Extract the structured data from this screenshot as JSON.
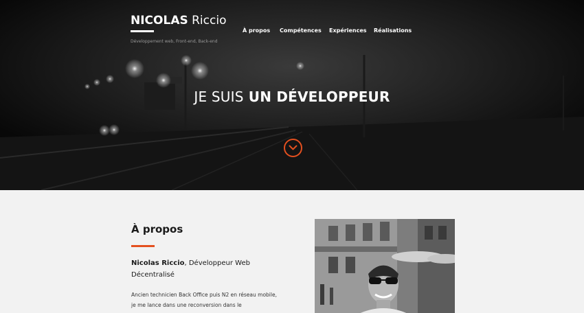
{
  "header": {
    "brand_bold": "NICOLAS",
    "brand_light": "Riccio",
    "tagline": "Développement web, Front-end, Back-end"
  },
  "nav": {
    "items": [
      "À propos",
      "Compétences",
      "Expériences",
      "Réalisations"
    ]
  },
  "hero": {
    "title_light": "JE SUIS",
    "title_bold": "UN DÉVELOPPEUR",
    "scroll_icon": "chevron-down-icon"
  },
  "about": {
    "title": "À propos",
    "lead_name": "Nicolas Riccio",
    "lead_rest": ", Développeur Web Décentralisé",
    "text_line1": "Ancien technicien Back Office puis N2 en réseau mobile,",
    "text_line2": "je me lance dans une reconversion dans le"
  },
  "colors": {
    "accent": "#e4501f",
    "hero_bg": "#0c0c0c",
    "section_bg": "#f2f2f2"
  }
}
